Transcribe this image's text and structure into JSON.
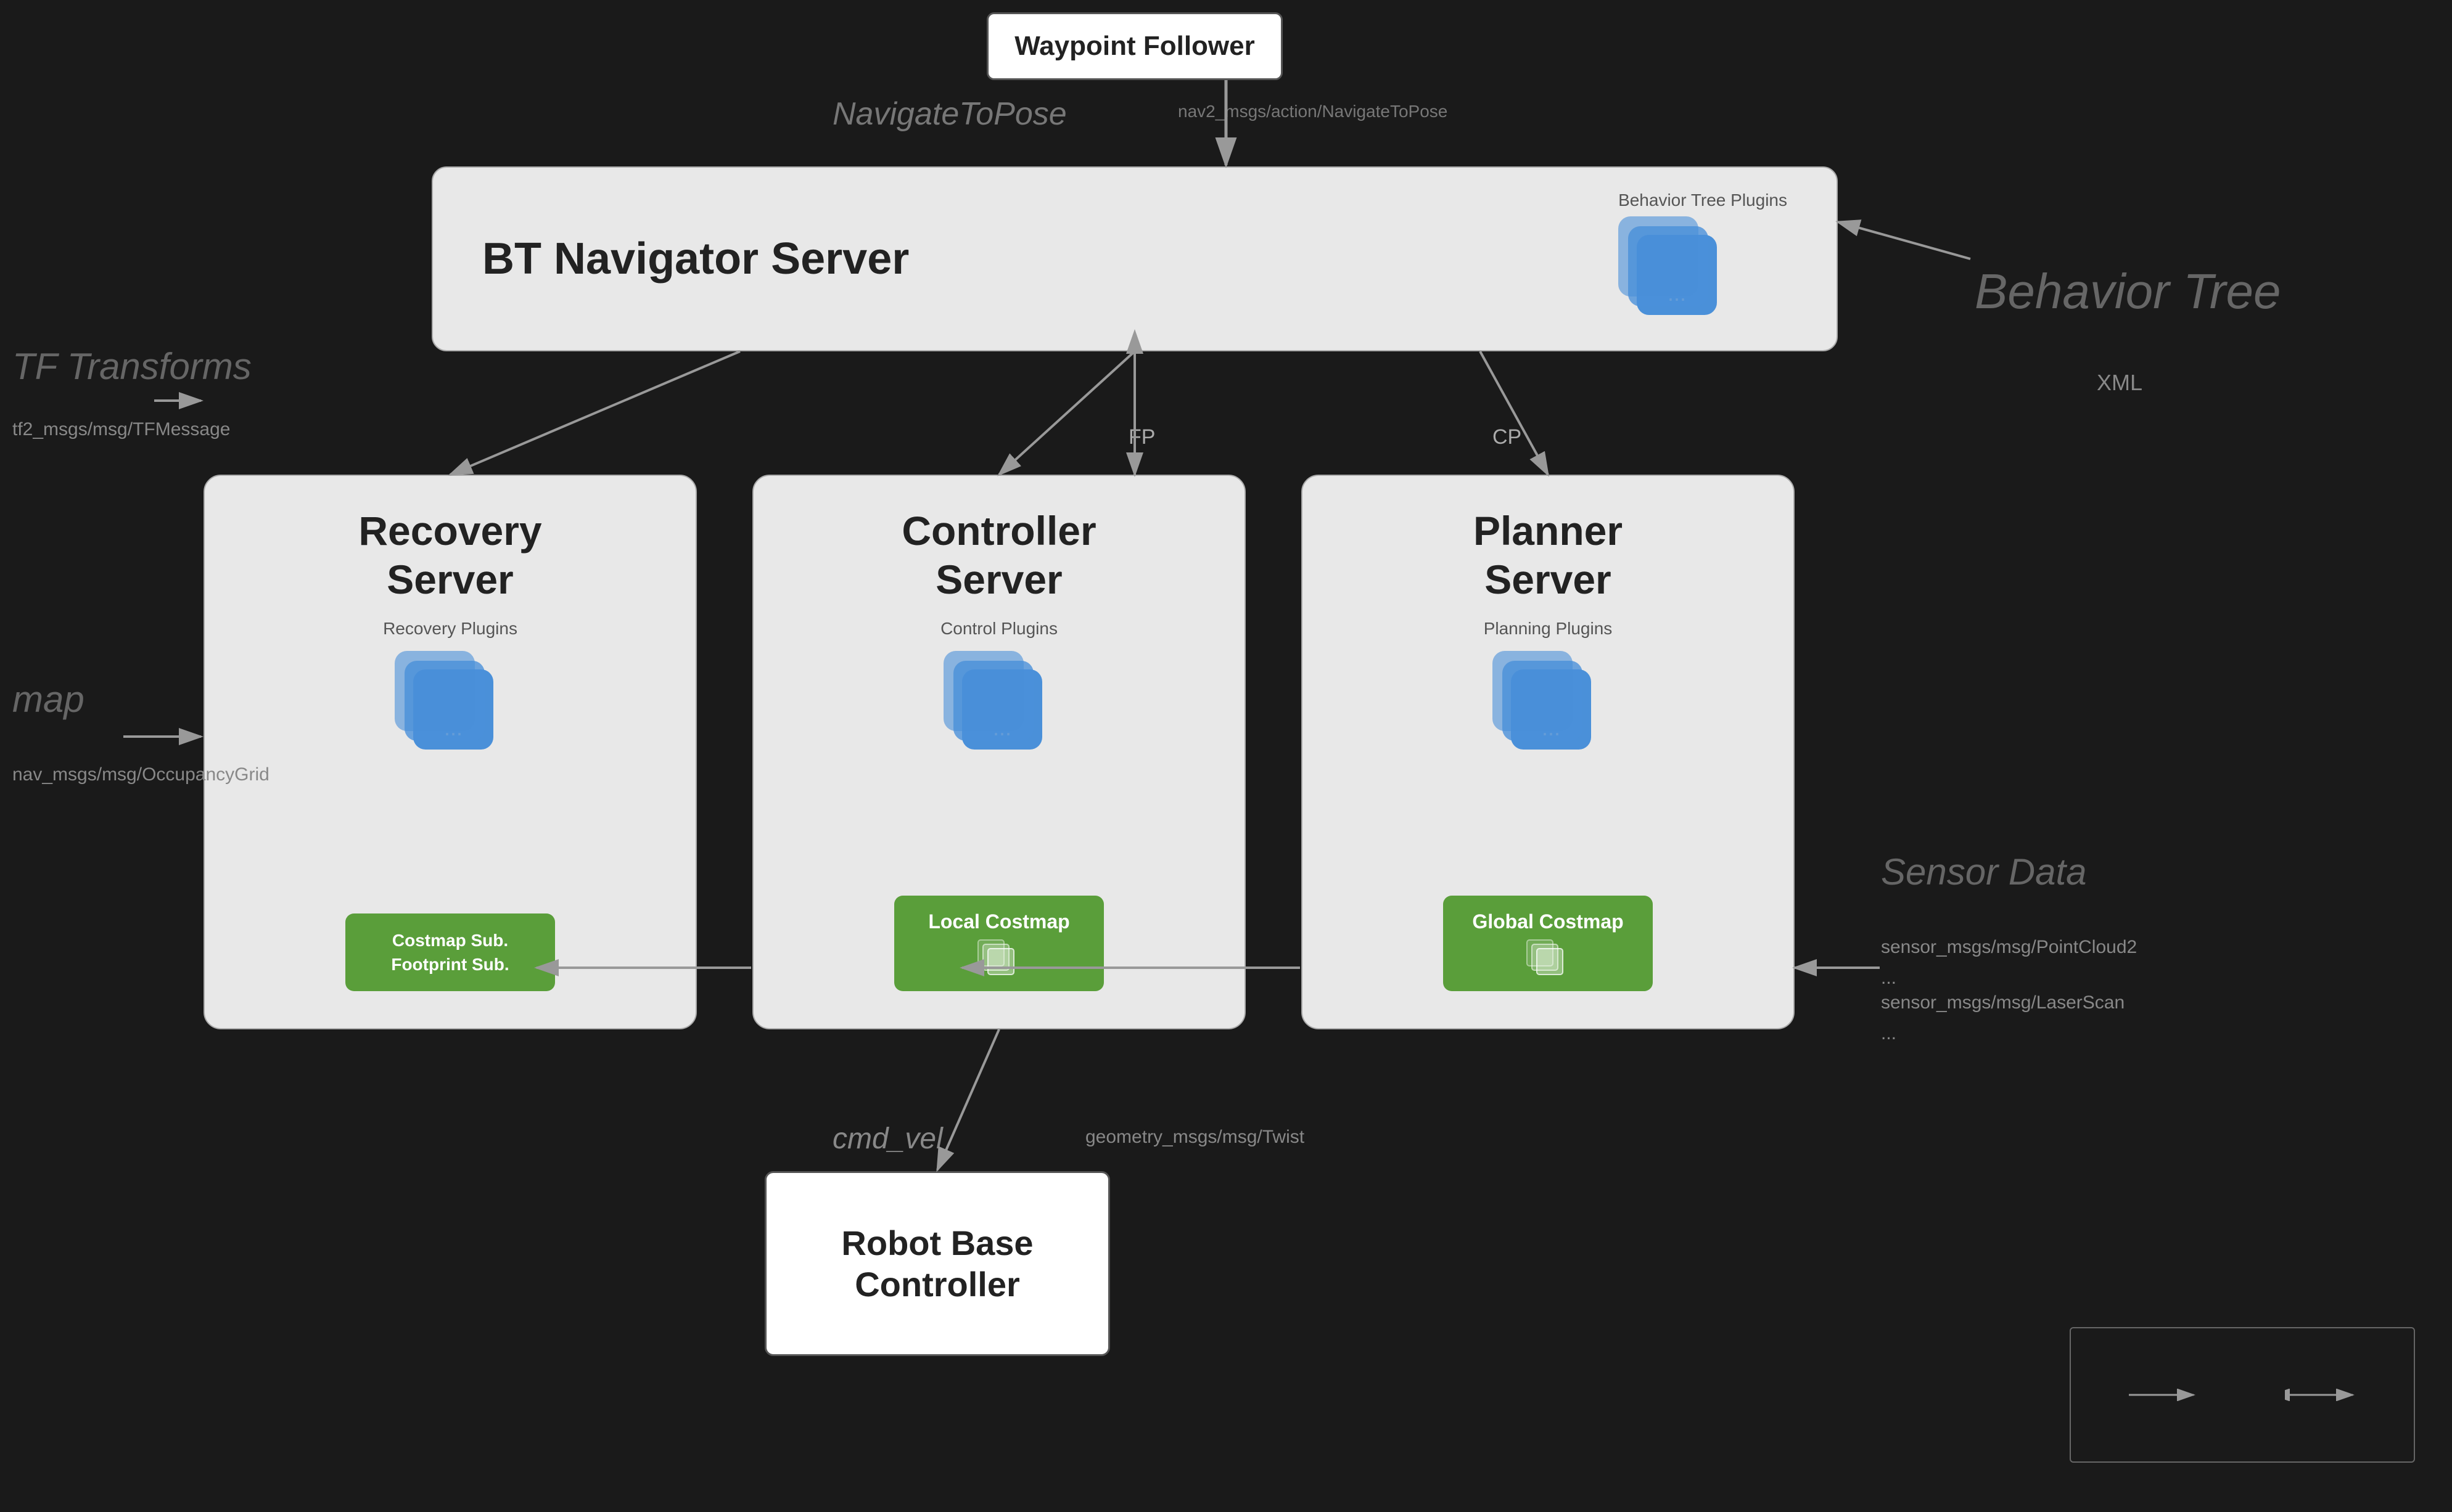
{
  "waypoint": {
    "title": "Waypoint Follower"
  },
  "navigate": {
    "label": "NavigateToPose",
    "msg": "nav2_msgs/action/NavigateToPose"
  },
  "bt_navigator": {
    "title": "BT Navigator Server",
    "plugins_label": "Behavior Tree Plugins"
  },
  "fp_label": "FP",
  "cp_label": "CP",
  "servers": [
    {
      "title": "Recovery\nServer",
      "plugins_label": "Recovery Plugins",
      "costmap_label": "Costmap Sub.\nFootprint Sub."
    },
    {
      "title": "Controller\nServer",
      "plugins_label": "Control Plugins",
      "costmap_label": "Local Costmap"
    },
    {
      "title": "Planner\nServer",
      "plugins_label": "Planning Plugins",
      "costmap_label": "Global Costmap"
    }
  ],
  "sidebar_left": {
    "tf_label": "TF Transforms",
    "tf_msg": "tf2_msgs/msg/TFMessage",
    "map_label": "map",
    "map_msg": "nav_msgs/msg/OccupancyGrid"
  },
  "sidebar_right": {
    "bt_label": "Behavior Tree",
    "bt_xml": "XML",
    "sensor_label": "Sensor Data",
    "sensor_msg1": "sensor_msgs/msg/PointCloud2",
    "sensor_msg2": "...",
    "sensor_msg3": "sensor_msgs/msg/LaserScan",
    "sensor_msg4": "..."
  },
  "cmdvel": {
    "label": "cmd_vel",
    "msg": "geometry_msgs/msg/Twist"
  },
  "robot_base": {
    "title": "Robot Base\nController"
  },
  "legend": {
    "arrow1_label": "→",
    "arrow2_label": "←→"
  }
}
